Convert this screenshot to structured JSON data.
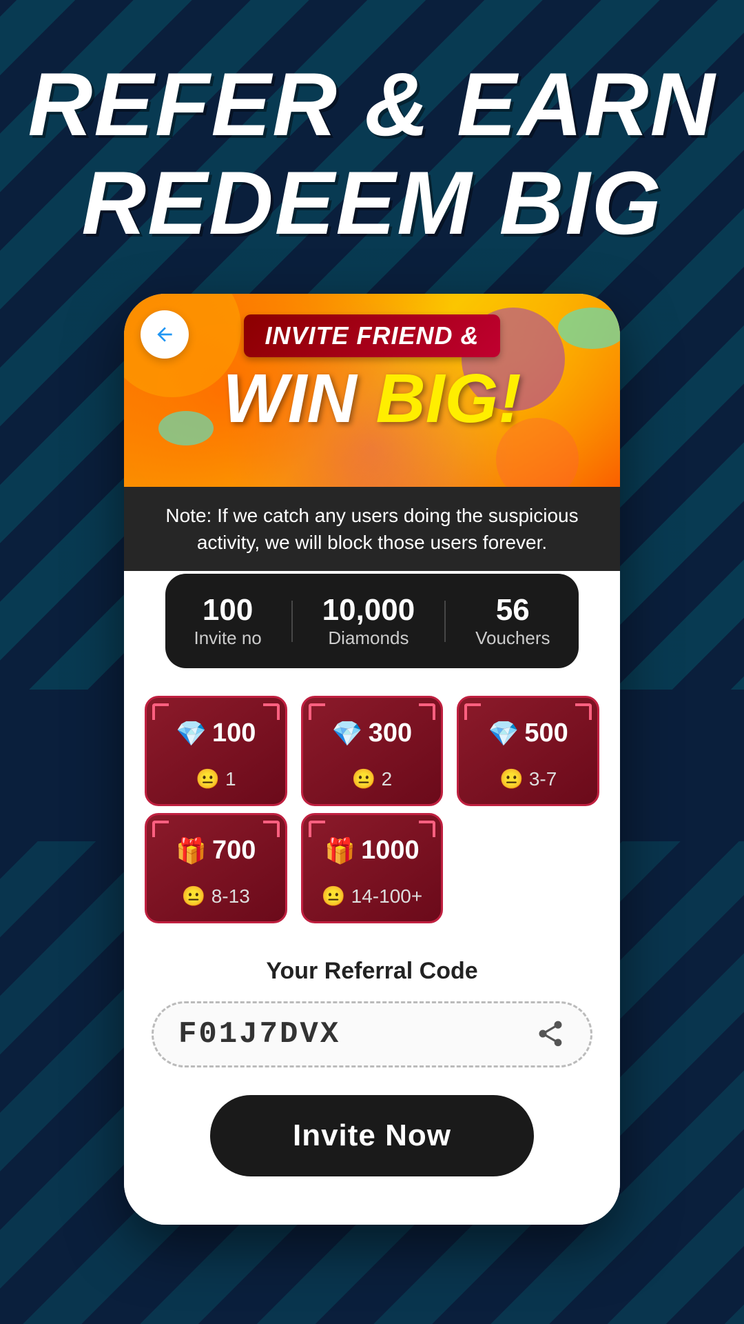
{
  "header": {
    "line1": "REFER & EARN",
    "line2": "REDEEM BIG"
  },
  "banner": {
    "invite_text": "INVITE FRIEND &",
    "win_text": "WIN",
    "win_exclaim": "BIG!",
    "note": "Note: If we catch any users doing the suspicious activity, we will block those users forever."
  },
  "stats": [
    {
      "value": "100",
      "label": "Invite no"
    },
    {
      "value": "10,000",
      "label": "Diamonds"
    },
    {
      "value": "56",
      "label": "Vouchers"
    }
  ],
  "rewards": [
    {
      "icon": "💎",
      "amount": "100",
      "invite_icon": "😐",
      "invite_range": "1"
    },
    {
      "icon": "💎",
      "amount": "300",
      "invite_icon": "😐",
      "invite_range": "2"
    },
    {
      "icon": "💎",
      "amount": "500",
      "invite_icon": "😐",
      "invite_range": "3-7"
    },
    {
      "icon": "🎁",
      "amount": "700",
      "invite_icon": "😐",
      "invite_range": "8-13"
    },
    {
      "icon": "🎁",
      "amount": "1000",
      "invite_icon": "😐",
      "invite_range": "14-100+"
    }
  ],
  "referral": {
    "label": "Your Referral Code",
    "code": "F01J7DVX"
  },
  "invite_button": {
    "label": "Invite Now"
  }
}
